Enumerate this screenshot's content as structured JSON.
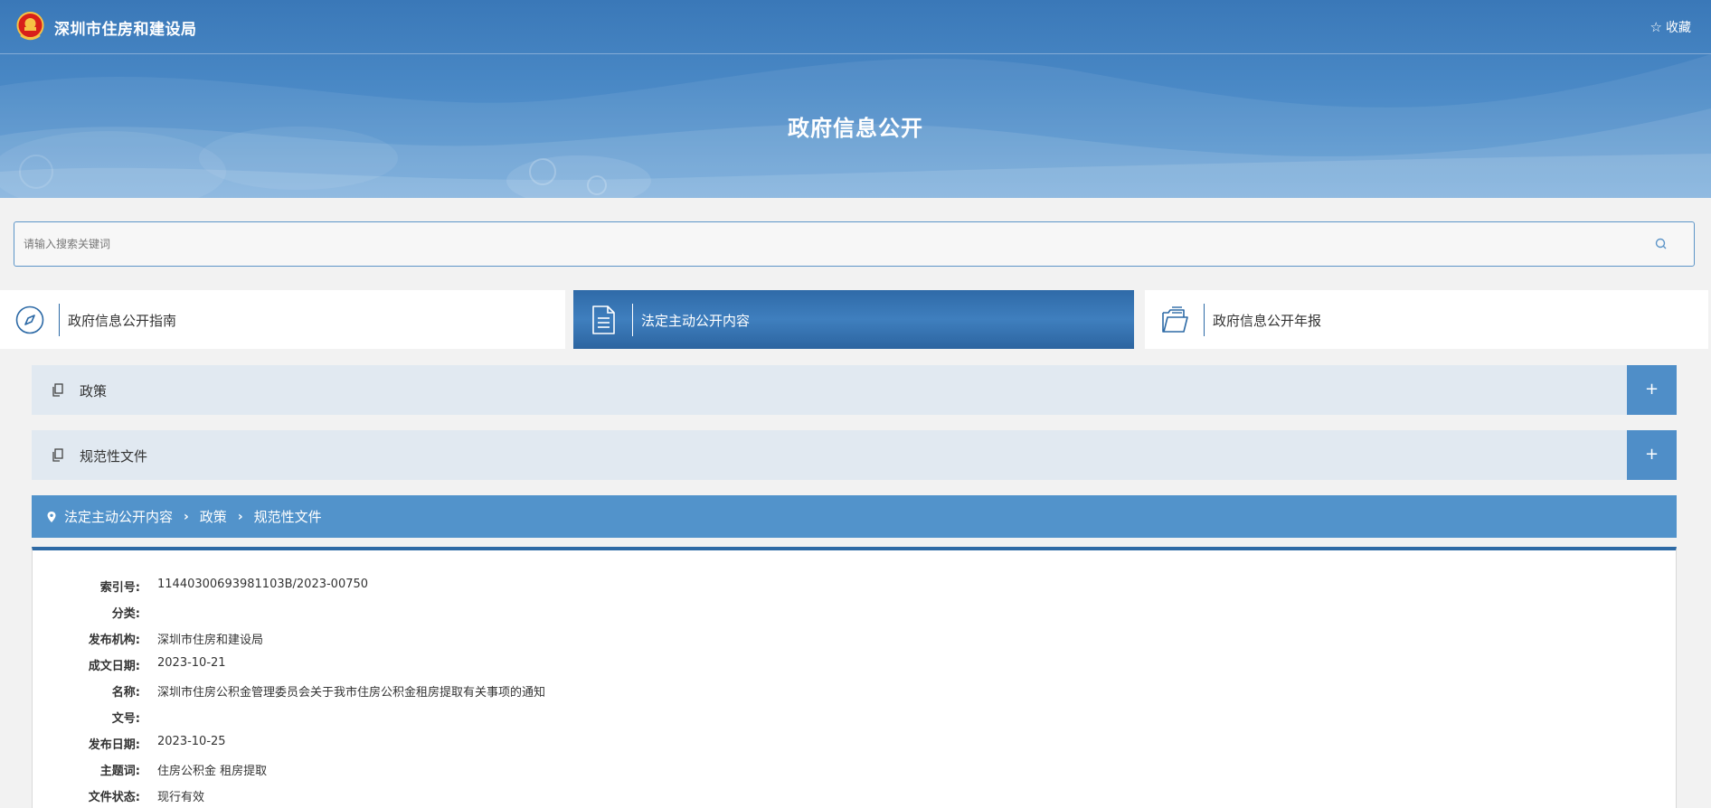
{
  "header": {
    "site_name": "深圳市住房和建设局",
    "favorite_label": "收藏",
    "banner_title": "政府信息公开"
  },
  "search": {
    "placeholder": "请输入搜索关键词",
    "value": ""
  },
  "tabs": [
    {
      "label": "政府信息公开指南",
      "icon": "compass-icon",
      "active": false
    },
    {
      "label": "法定主动公开内容",
      "icon": "document-icon",
      "active": true
    },
    {
      "label": "政府信息公开年报",
      "icon": "folder-icon",
      "active": false
    }
  ],
  "accordion": [
    {
      "label": "政策",
      "toggle": "+"
    },
    {
      "label": "规范性文件",
      "toggle": "+"
    }
  ],
  "breadcrumb": [
    "法定主动公开内容",
    "政策",
    "规范性文件"
  ],
  "detail": [
    {
      "key": "索引号:",
      "value": "11440300693981103B/2023-00750"
    },
    {
      "key": "分类:",
      "value": ""
    },
    {
      "key": "发布机构:",
      "value": "深圳市住房和建设局"
    },
    {
      "key": "成文日期:",
      "value": "2023-10-21"
    },
    {
      "key": "名称:",
      "value": "深圳市住房公积金管理委员会关于我市住房公积金租房提取有关事项的通知"
    },
    {
      "key": "文号:",
      "value": ""
    },
    {
      "key": "发布日期:",
      "value": "2023-10-25"
    },
    {
      "key": "主题词:",
      "value": "住房公积金 租房提取"
    },
    {
      "key": "文件状态:",
      "value": "现行有效"
    }
  ],
  "colors": {
    "banner": "#4a89c6",
    "active_tab": "#2f6aa8",
    "accordion_bg": "#e1e9f1",
    "accordion_toggle": "#4f8ec8",
    "breadcrumb_bg": "#5293cb",
    "detail_top_border": "#2e6aa5"
  }
}
